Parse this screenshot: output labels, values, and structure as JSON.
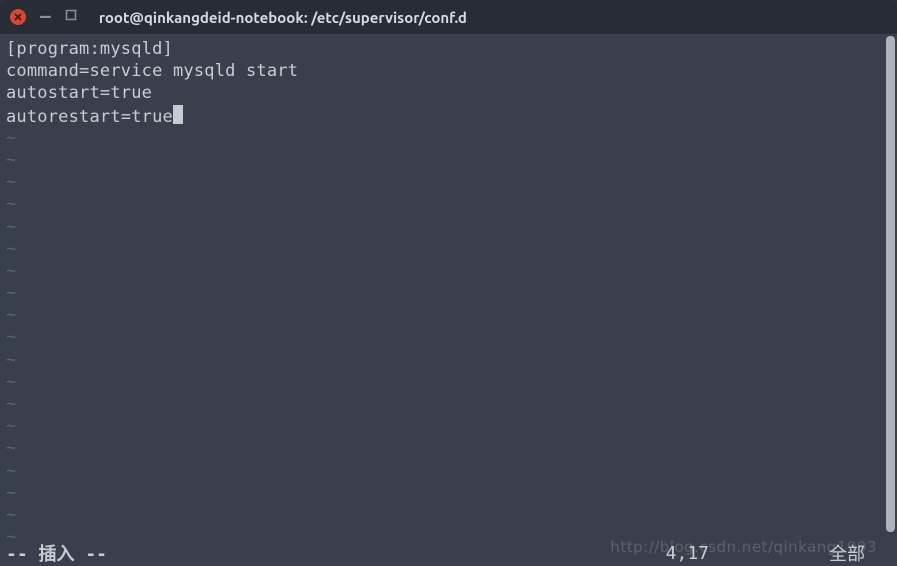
{
  "window": {
    "title": "root@qinkangdeid-notebook: /etc/supervisor/conf.d"
  },
  "editor": {
    "lines": [
      "[program:mysqld]",
      "command=service mysqld start",
      "autostart=true",
      "autorestart=true"
    ],
    "cursor_line_index": 3,
    "tilde_count": 19
  },
  "status": {
    "mode": "-- 插入 --",
    "position": "4,17",
    "scroll": "全部"
  },
  "watermark": "http://blog.csdn.net/qinkang1993"
}
